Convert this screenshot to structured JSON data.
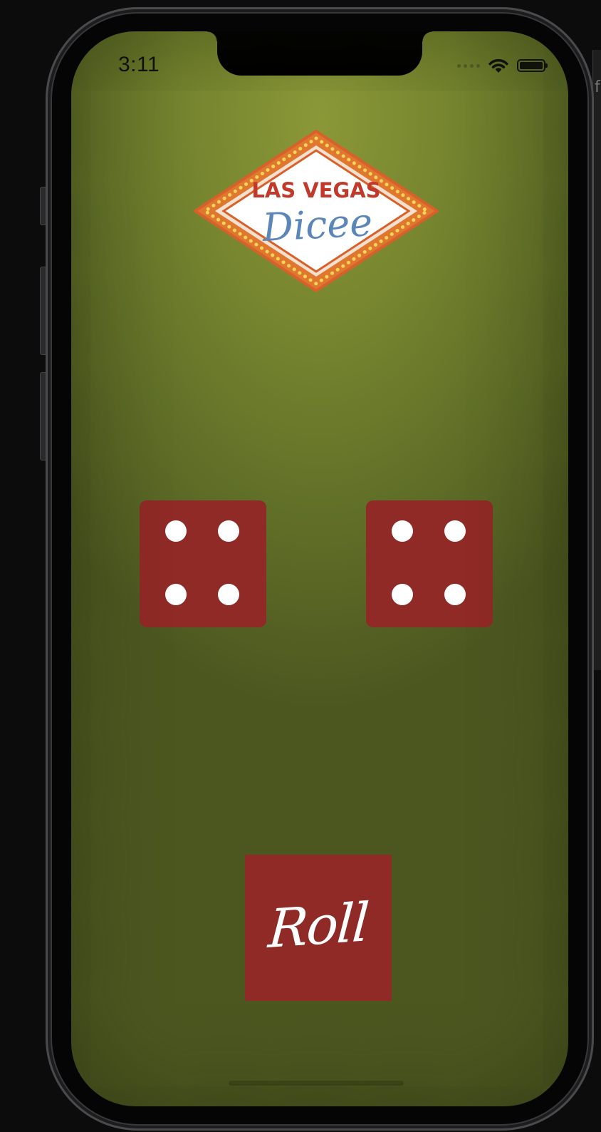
{
  "status_bar": {
    "time": "3:11"
  },
  "logo": {
    "line1": "LAS VEGAS",
    "line2": "Dicee"
  },
  "dice": [
    {
      "value": 4
    },
    {
      "value": 4
    }
  ],
  "roll_button": {
    "label": "Roll"
  },
  "colors": {
    "felt": "#77862f",
    "die": "#8f2a26",
    "logo_red": "#c0392b",
    "logo_blue": "#5b86b8",
    "logo_border": "#e0772e"
  }
}
